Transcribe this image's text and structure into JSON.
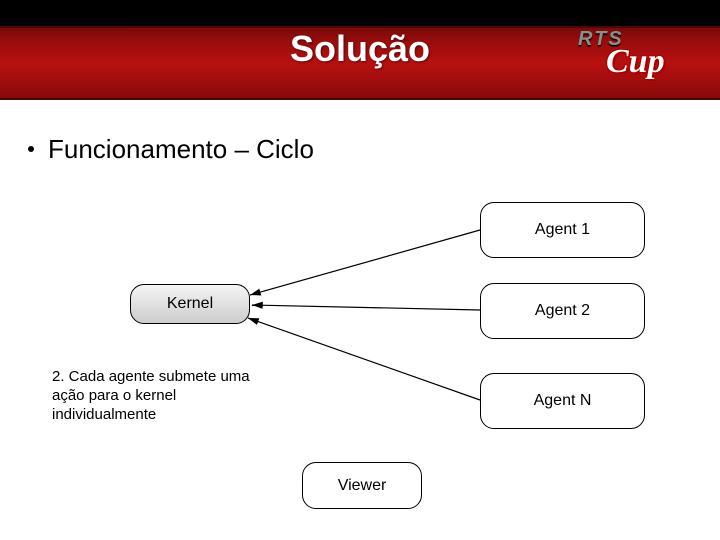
{
  "header": {
    "title": "Solução",
    "logo_line1": "RTS",
    "logo_line2": "Cup"
  },
  "bullet": {
    "text": "Funcionamento – Ciclo"
  },
  "diagram": {
    "kernel": "Kernel",
    "agent1": "Agent 1",
    "agent2": "Agent 2",
    "agentN": "Agent N",
    "viewer": "Viewer",
    "caption": "2. Cada agente submete uma ação para o kernel individualmente"
  }
}
